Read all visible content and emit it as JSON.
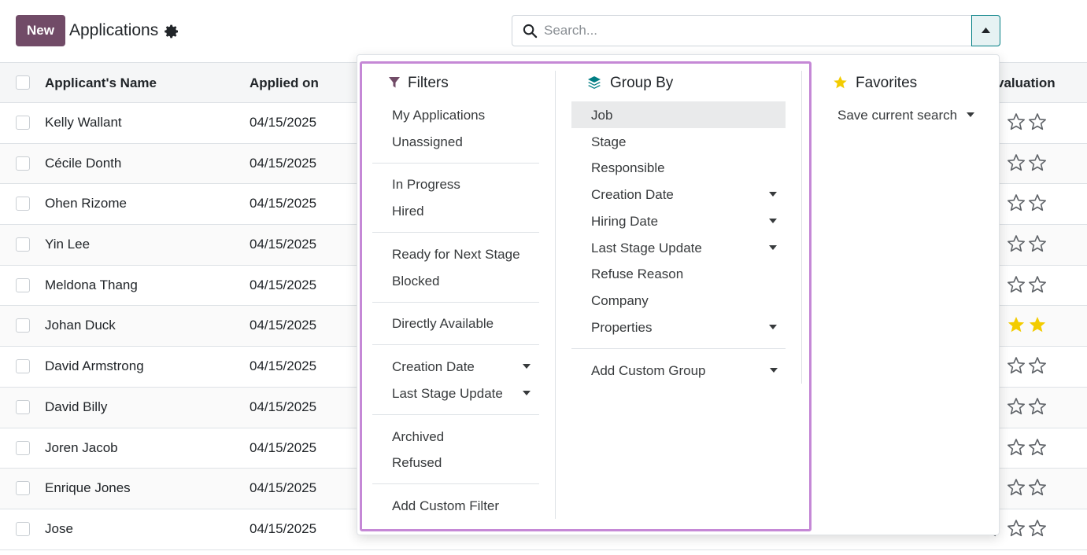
{
  "header": {
    "new_label": "New",
    "title": "Applications",
    "settings_icon": "gear-icon"
  },
  "search": {
    "placeholder": "Search...",
    "icon": "search-icon",
    "toggle_icon": "caret-up-icon"
  },
  "table": {
    "columns": [
      "Applicant's Name",
      "Applied on",
      "Evaluation"
    ],
    "evaluation_visible_text": "valuation",
    "rows": [
      {
        "name": "Kelly Wallant",
        "applied_on": "04/15/2025",
        "stars": 0
      },
      {
        "name": "Cécile Donth",
        "applied_on": "04/15/2025",
        "stars": 0
      },
      {
        "name": "Ohen Rizome",
        "applied_on": "04/15/2025",
        "stars": 0
      },
      {
        "name": "Yin Lee",
        "applied_on": "04/15/2025",
        "stars": 0
      },
      {
        "name": "Meldona Thang",
        "applied_on": "04/15/2025",
        "stars": 1
      },
      {
        "name": "Johan Duck",
        "applied_on": "04/15/2025",
        "stars": 3
      },
      {
        "name": "David Armstrong",
        "applied_on": "04/15/2025",
        "stars": 1
      },
      {
        "name": "David Billy",
        "applied_on": "04/15/2025",
        "stars": 0
      },
      {
        "name": "Joren Jacob",
        "applied_on": "04/15/2025",
        "stars": 1
      },
      {
        "name": "Enrique Jones",
        "applied_on": "04/15/2025",
        "stars": 1
      },
      {
        "name": "Jose",
        "applied_on": "04/15/2025",
        "stars": 0
      }
    ]
  },
  "filters": {
    "title": "Filters",
    "icon": "filter-icon",
    "groups": [
      [
        "My Applications",
        "Unassigned"
      ],
      [
        "In Progress",
        "Hired"
      ],
      [
        "Ready for Next Stage",
        "Blocked"
      ],
      [
        "Directly Available"
      ],
      [
        "Creation Date",
        "Last Stage Update"
      ],
      [
        "Archived",
        "Refused"
      ],
      [
        "Add Custom Filter"
      ]
    ]
  },
  "group_by": {
    "title": "Group By",
    "icon": "layers-icon",
    "items": [
      "Job",
      "Stage",
      "Responsible",
      "Creation Date",
      "Hiring Date",
      "Last Stage Update",
      "Refuse Reason",
      "Company",
      "Properties"
    ],
    "add_custom": "Add Custom Group",
    "highlighted": "Job"
  },
  "favorites": {
    "title": "Favorites",
    "icon": "star-icon",
    "save_current": "Save current search"
  },
  "colors": {
    "brand": "#714b67",
    "star_filled": "#f3cc00",
    "highlight_border": "#c588d6",
    "filter_icon": "#714b67",
    "groupby_icon": "#017e84"
  }
}
